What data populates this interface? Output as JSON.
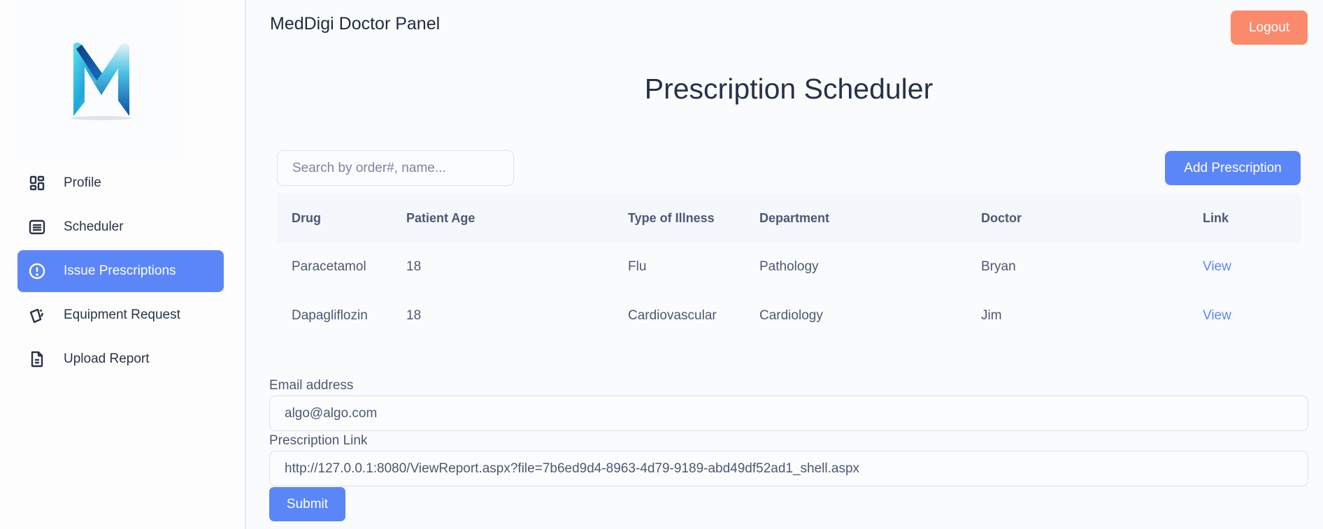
{
  "app": {
    "title": "MedDigi Doctor Panel",
    "logo_name": "MedDigi M logo"
  },
  "colors": {
    "primary": "#5b86f7",
    "logout": "#fa8a6b",
    "text_dark": "#1f2a44",
    "text_muted": "#4c5873"
  },
  "sidebar": {
    "items": [
      {
        "label": "Profile",
        "icon": "dashboard-grid-icon",
        "active": false
      },
      {
        "label": "Scheduler",
        "icon": "list-document-icon",
        "active": false
      },
      {
        "label": "Issue Prescriptions",
        "icon": "alert-circle-icon",
        "active": true
      },
      {
        "label": "Equipment Request",
        "icon": "cards-icon",
        "active": false
      },
      {
        "label": "Upload Report",
        "icon": "file-text-icon",
        "active": false
      }
    ]
  },
  "header": {
    "logout_label": "Logout"
  },
  "main": {
    "page_title": "Prescription Scheduler",
    "search": {
      "placeholder": "Search by order#, name...",
      "value": ""
    },
    "add_button_label": "Add Prescription",
    "table": {
      "columns": [
        "Drug",
        "Patient Age",
        "Type of Illness",
        "Department",
        "Doctor",
        "Link"
      ],
      "rows": [
        {
          "drug": "Paracetamol",
          "age": "18",
          "illness": "Flu",
          "department": "Pathology",
          "doctor": "Bryan",
          "link": "View"
        },
        {
          "drug": "Dapagliflozin",
          "age": "18",
          "illness": "Cardiovascular",
          "department": "Cardiology",
          "doctor": "Jim",
          "link": "View"
        }
      ]
    },
    "form": {
      "email_label": "Email address",
      "email_value": "algo@algo.com",
      "link_label": "Prescription Link",
      "link_value": "http://127.0.0.1:8080/ViewReport.aspx?file=7b6ed9d4-8963-4d79-9189-abd49df52ad1_shell.aspx",
      "submit_label": "Submit"
    }
  }
}
